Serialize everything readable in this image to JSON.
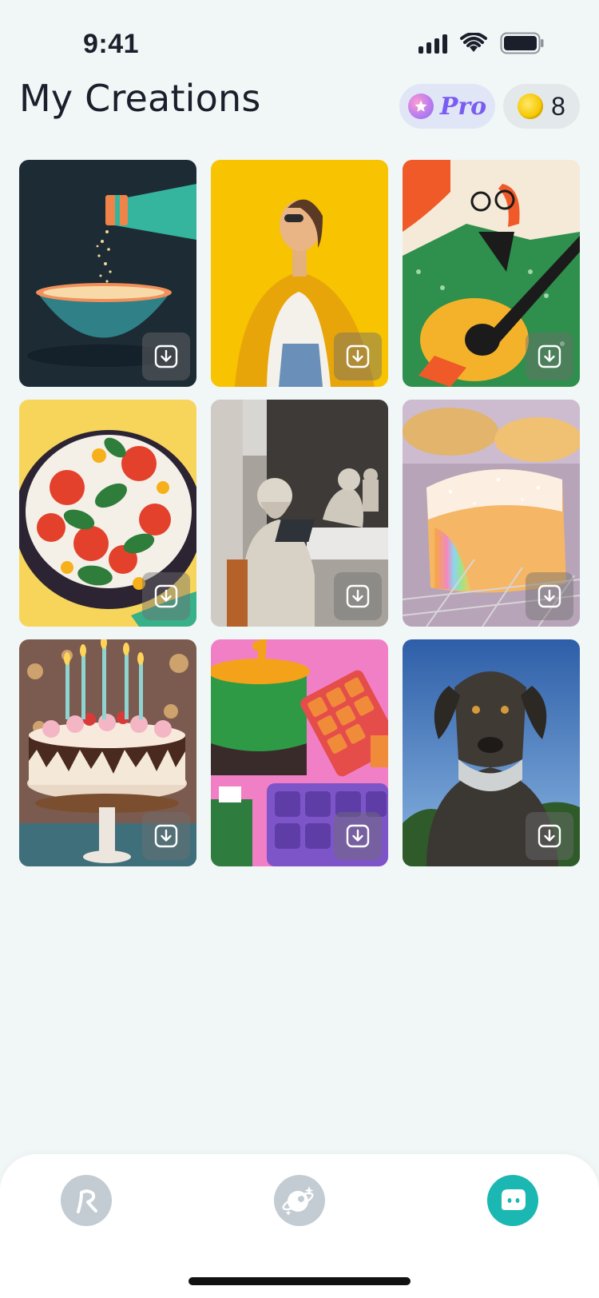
{
  "status_bar": {
    "time": "9:41"
  },
  "header": {
    "title": "My Creations",
    "pro_label": "Pro",
    "coin_count": "8"
  },
  "gallery": {
    "items": [
      {
        "name": "soup-pouring-illustration"
      },
      {
        "name": "woman-yellow-jacket-photo"
      },
      {
        "name": "guitar-player-illustration"
      },
      {
        "name": "caprese-salad-illustration"
      },
      {
        "name": "statues-on-laptops-photo"
      },
      {
        "name": "rainbow-glitter-bread-photo"
      },
      {
        "name": "birthday-cake-photo"
      },
      {
        "name": "cooking-pot-illustration"
      },
      {
        "name": "great-dane-photo"
      }
    ]
  },
  "colors": {
    "background": "#f1f6f7",
    "accent_teal": "#1bb7b2",
    "pro_purple": "#7b5cf2",
    "nav_inactive": "#c3ccd3"
  },
  "nav": {
    "items": [
      {
        "icon": "r-logo-icon",
        "active": false
      },
      {
        "icon": "sparkle-planet-icon",
        "active": false
      },
      {
        "icon": "profile-face-icon",
        "active": true
      }
    ]
  }
}
